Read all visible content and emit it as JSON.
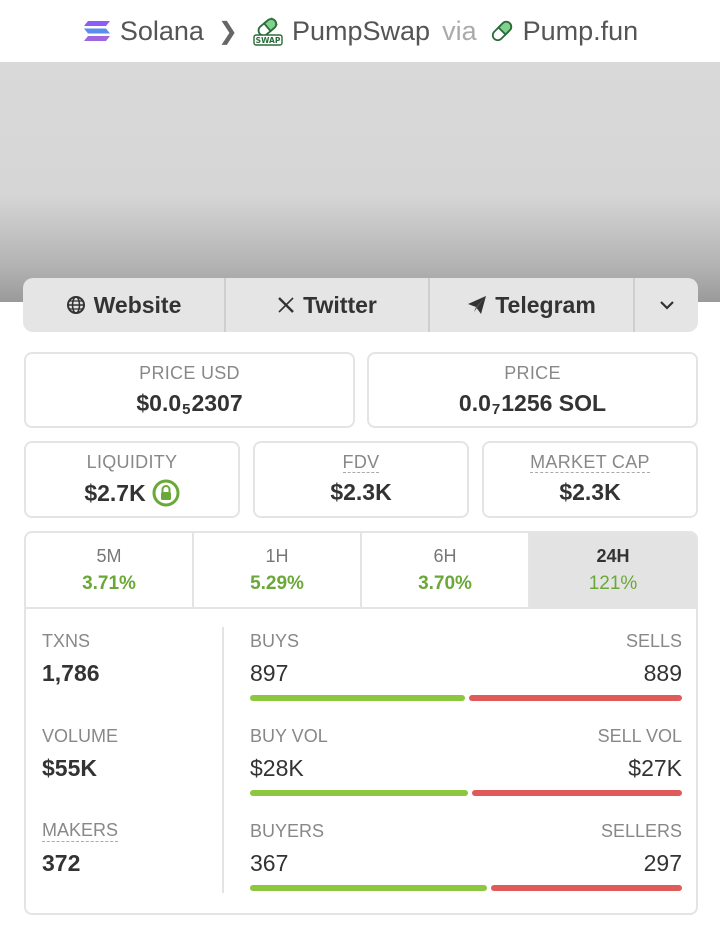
{
  "breadcrumb": {
    "chain": "Solana",
    "dex": "PumpSwap",
    "via": "via",
    "source": "Pump.fun",
    "dex_badge": "SWAP"
  },
  "links": {
    "website": "Website",
    "twitter": "Twitter",
    "telegram": "Telegram"
  },
  "stats": {
    "price_usd": {
      "label": "PRICE USD",
      "prefix": "$0.0",
      "sub": "5",
      "suffix": "2307"
    },
    "price_sol": {
      "label": "PRICE",
      "prefix": "0.0",
      "sub": "7",
      "suffix": "1256 SOL"
    },
    "liquidity": {
      "label": "LIQUIDITY",
      "value": "$2.7K"
    },
    "fdv": {
      "label": "FDV",
      "value": "$2.3K"
    },
    "market_cap": {
      "label": "MARKET CAP",
      "value": "$2.3K"
    }
  },
  "periods": [
    {
      "label": "5M",
      "value": "3.71%"
    },
    {
      "label": "1H",
      "value": "5.29%"
    },
    {
      "label": "6H",
      "value": "3.70%"
    },
    {
      "label": "24H",
      "value": "121%"
    }
  ],
  "active_period": "24H",
  "txns": {
    "txns_label": "TXNS",
    "txns_value": "1,786",
    "buys_label": "BUYS",
    "buys_value": "897",
    "sells_label": "SELLS",
    "sells_value": "889",
    "buys_share": 0.502
  },
  "volume": {
    "volume_label": "VOLUME",
    "volume_value": "$55K",
    "buy_vol_label": "BUY VOL",
    "buy_vol_value": "$28K",
    "sell_vol_label": "SELL VOL",
    "sell_vol_value": "$27K",
    "buys_share": 0.509
  },
  "makers": {
    "makers_label": "MAKERS",
    "makers_value": "372",
    "buyers_label": "BUYERS",
    "buyers_value": "367",
    "sellers_label": "SELLERS",
    "sellers_value": "297",
    "buys_share": 0.553
  },
  "colors": {
    "positive": "#6aa837",
    "buy_bar": "#8dc63f",
    "sell_bar": "#e05a5a"
  }
}
